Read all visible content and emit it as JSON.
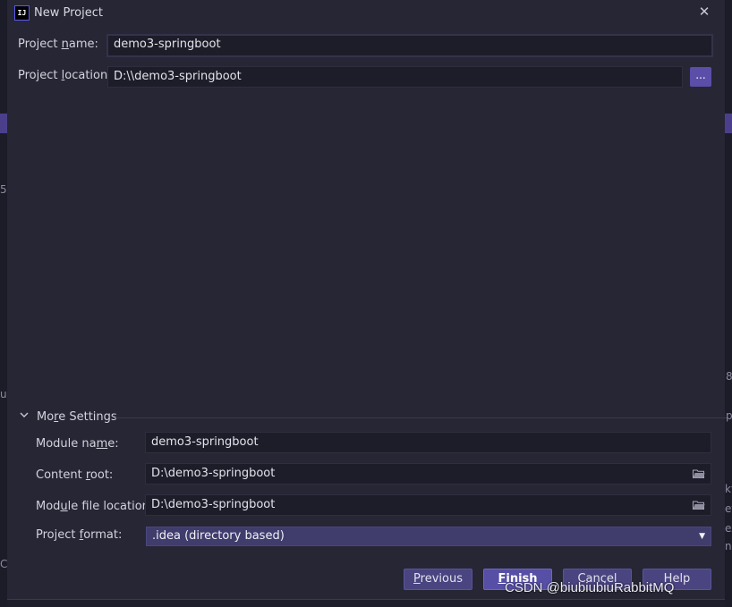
{
  "window": {
    "title": "New Project",
    "logo": "IJ"
  },
  "project": {
    "name_label_before": "Project ",
    "name_label_mnemonic": "n",
    "name_label_after": "ame:",
    "name_value": "demo3-springboot",
    "location_label_before": "Project ",
    "location_label_mnemonic": "l",
    "location_label_after": "ocation:",
    "location_value": "D:\\\\demo3-springboot",
    "browse_label": "..."
  },
  "more_settings": {
    "label_before": "Mo",
    "label_mnemonic": "r",
    "label_after": "e Settings",
    "module_name_label_before": "Module na",
    "module_name_label_mnemonic": "m",
    "module_name_label_after": "e:",
    "module_name_value": "demo3-springboot",
    "content_root_label_before": "Content ",
    "content_root_label_mnemonic": "r",
    "content_root_label_after": "oot:",
    "content_root_value": "D:\\demo3-springboot",
    "module_file_label_before": "Mod",
    "module_file_label_mnemonic": "u",
    "module_file_label_after": "le file location:",
    "module_file_value": "D:\\demo3-springboot",
    "format_label_before": "Project ",
    "format_label_mnemonic": "f",
    "format_label_after": "ormat:",
    "format_value": ".idea (directory based)"
  },
  "buttons": {
    "previous_mnemonic": "P",
    "previous_rest": "revious",
    "finish_mnemonic": "F",
    "finish_rest": "inish",
    "cancel": "Cancel",
    "help": "Help"
  },
  "watermark": "CSDN @biubiubiuRabbitMQ",
  "background_fragments": [
    "5",
    "u",
    "8",
    "p",
    "kt",
    "et",
    "ex",
    "no",
    "C"
  ],
  "colors": {
    "accent": "#574fa6",
    "background": "#262635",
    "field": "#1d1d2a"
  },
  "icons": {
    "dropdown": "triangle-down",
    "folder": "folder-open",
    "close": "close-x",
    "expand": "chevron-down"
  }
}
